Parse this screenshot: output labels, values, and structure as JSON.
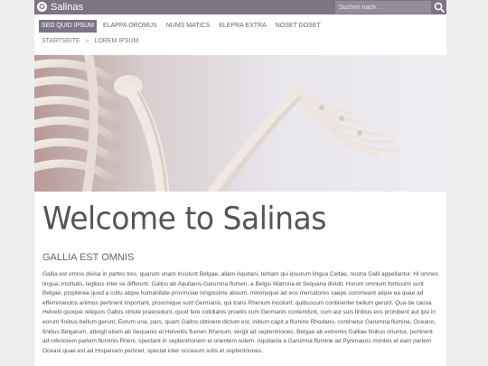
{
  "site": {
    "title": "Salinas",
    "search_placeholder": "Suchen nach …",
    "accent_color": "#7d7486"
  },
  "nav": {
    "items": [
      {
        "label": "SED QUID IPSUM"
      },
      {
        "label": "ELAPPA OROMUS"
      },
      {
        "label": "NUMS MATICS"
      },
      {
        "label": "ELEPRA EXTRA"
      },
      {
        "label": "NOSET DOSET"
      }
    ],
    "active_index": 0
  },
  "breadcrumb": {
    "items": [
      "STARTSEITE",
      "LOREM IPSUM"
    ],
    "separator": "»"
  },
  "main": {
    "headline": "Welcome to Salinas",
    "subheading": "GALLIA EST OMNIS",
    "body": "Gallia est omnis divisa in partes tres, quarum unam incolunt Belgae, aliam Aquitani, tertiam qui ipsorum lingua Celtae, nostra Galli appellantur. Hi omnes lingua, institutis, legibus inter se differunt. Gallos ab Aquitanis Garumna flumen, a Belgis Matrona et Sequana dividit. Horum omnium fortissimi sunt Belgae, propterea quod a cultu atque humanitate provinciae longissime absunt, minimeque ad eos mercatores saepe commeant atque ea quae ad effeminandos animos pertinent important, proximique sunt Germanis, qui trans Rhenum incolunt, quibuscum continenter bellum gerunt. Qua de causa Helvetii quoque reliquos Gallos virtute praecedunt, quod fere cotidianis proeliis cum Germanis contendunt, cum aut suis finibus eos prohibent aut ipsi in eorum finibus bellum gerunt. Eorum una, pars, quam Gallos obtinere dictum est, initium capit a flumine Rhodano, continetur Garumna flumine, Oceano, finibus Belgarum, attingit etiam ab Sequanis et Helvetiis flumen Rhenum, vergit ad septentriones. Belgae ab extremis Galliae finibus oriuntur, pertinent ad inferiorem partem fluminis Rheni, spectant in septentrionem et orientem solem. Aquitania a Garumna flumine ad Pyrenaeos montes et eam partem Oceani quae est ad Hispaniam pertinet; spectat inter occasum solis et septentriones."
  }
}
